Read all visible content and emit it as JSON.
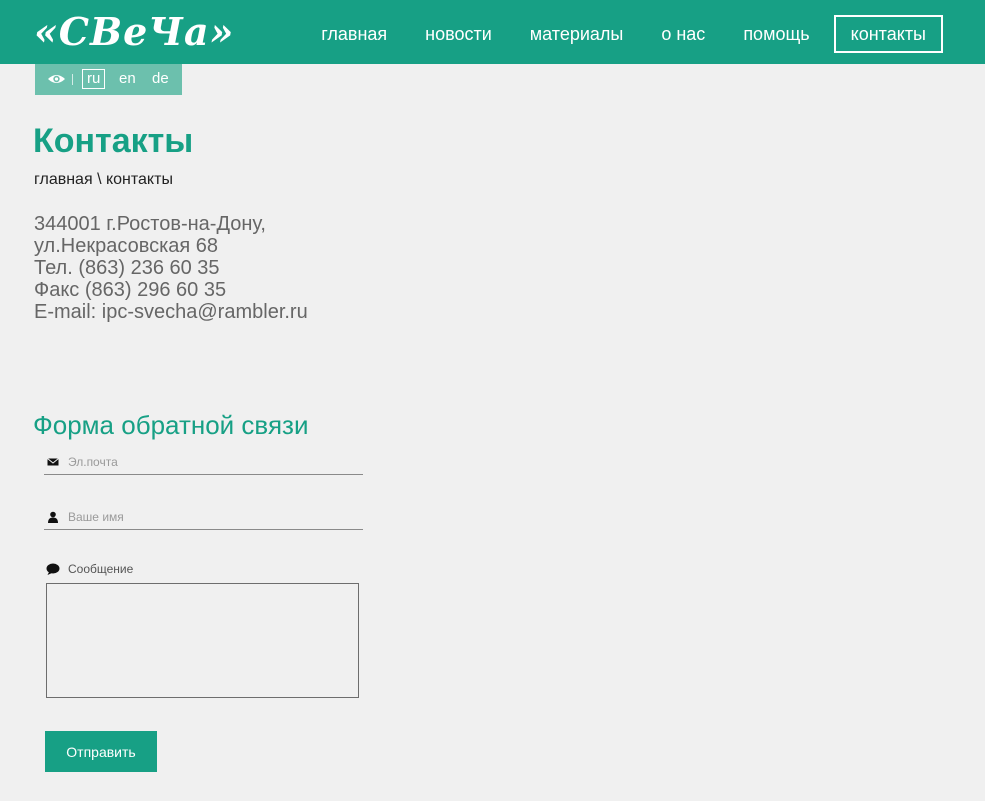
{
  "header": {
    "logo_text": "«СВеЧа»",
    "nav": [
      {
        "label": "главная"
      },
      {
        "label": "новости"
      },
      {
        "label": "материалы"
      },
      {
        "label": "о нас"
      },
      {
        "label": "помощь"
      },
      {
        "label": "контакты",
        "active": true
      }
    ],
    "accent_color": "#17a085"
  },
  "lang_bar": {
    "icon": "eye-icon",
    "languages": [
      {
        "code": "ru",
        "active": true
      },
      {
        "code": "en"
      },
      {
        "code": "de"
      }
    ]
  },
  "page": {
    "title": "Контакты",
    "breadcrumb": {
      "home": "главная",
      "separator": " \\ ",
      "current": "контакты"
    },
    "address": {
      "line1": "344001 г.Ростов-на-Дону,",
      "line2": "ул.Некрасовская 68",
      "phone": "Тел. (863) 236 60 35",
      "fax": "Факс (863) 296 60 35",
      "email": "E-mail: ipc-svecha@rambler.ru"
    }
  },
  "feedback_form": {
    "title": "Форма обратной связи",
    "email_placeholder": "Эл.почта",
    "name_placeholder": "Ваше имя",
    "message_label": "Сообщение",
    "message_value": "",
    "submit_label": "Отправить"
  }
}
